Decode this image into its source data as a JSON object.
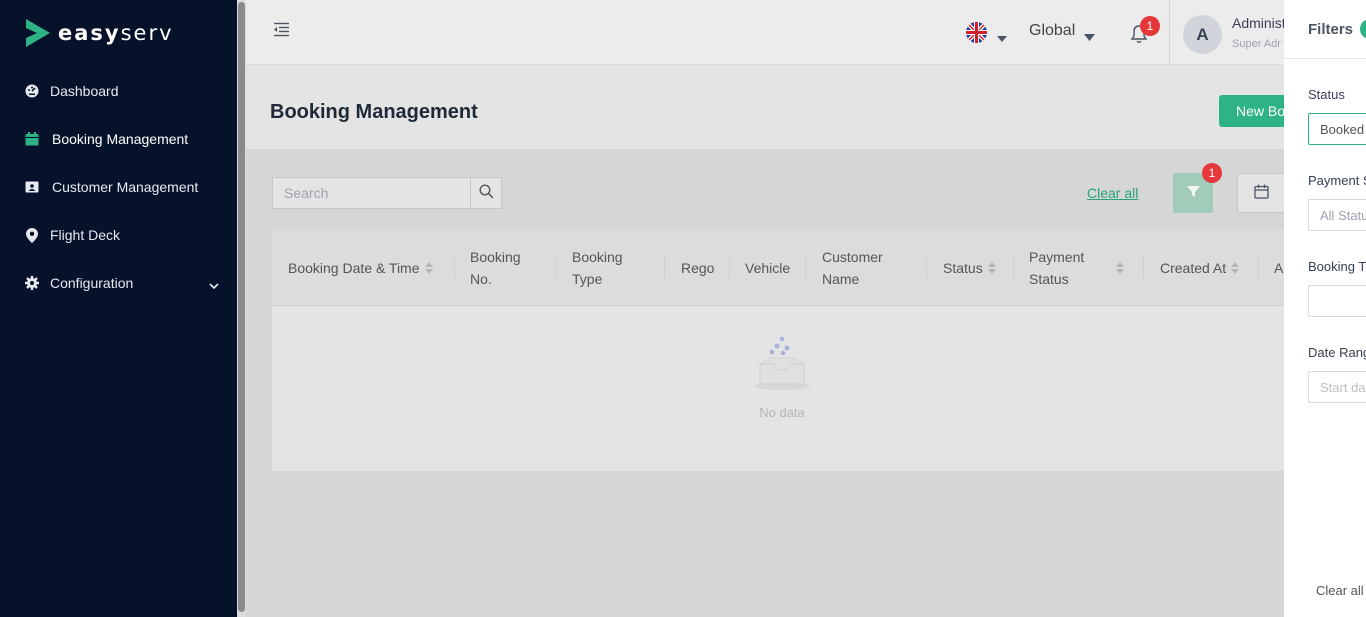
{
  "colors": {
    "sidebar_bg": "#06112a",
    "accent": "#2db386",
    "badge": "#e5383b"
  },
  "brand": {
    "name_bold": "easy",
    "name_light": "serv"
  },
  "sidebar": {
    "items": [
      {
        "label": "Dashboard",
        "icon": "dashboard-icon"
      },
      {
        "label": "Booking Management",
        "icon": "calendar-icon"
      },
      {
        "label": "Customer Management",
        "icon": "contact-card-icon"
      },
      {
        "label": "Flight Deck",
        "icon": "location-pin-icon"
      },
      {
        "label": "Configuration",
        "icon": "gear-icon"
      }
    ]
  },
  "header": {
    "language_icon": "uk-flag-icon",
    "region": "Global",
    "notifications_count": "1",
    "avatar_initial": "A",
    "user_name": "Administ",
    "user_role": "Super Adr"
  },
  "page": {
    "title": "Booking Management",
    "new_button": "New Bo"
  },
  "toolbar": {
    "search_placeholder": "Search",
    "clear_all": "Clear all",
    "filter_count": "1"
  },
  "table": {
    "columns": [
      "Booking Date & Time",
      "Booking No.",
      "Booking Type",
      "Rego",
      "Vehicle",
      "Customer Name",
      "Status",
      "Payment Status",
      "Created At",
      "A"
    ],
    "empty_text": "No data"
  },
  "filters": {
    "title": "Filters",
    "status_label": "Status",
    "status_value": "Booked",
    "payment_label": "Payment S",
    "payment_value": "All Statu",
    "booking_type_label": "Booking T",
    "booking_type_value": "",
    "date_range_label": "Date Rang",
    "date_range_placeholder": "Start da",
    "clear_all": "Clear all"
  }
}
